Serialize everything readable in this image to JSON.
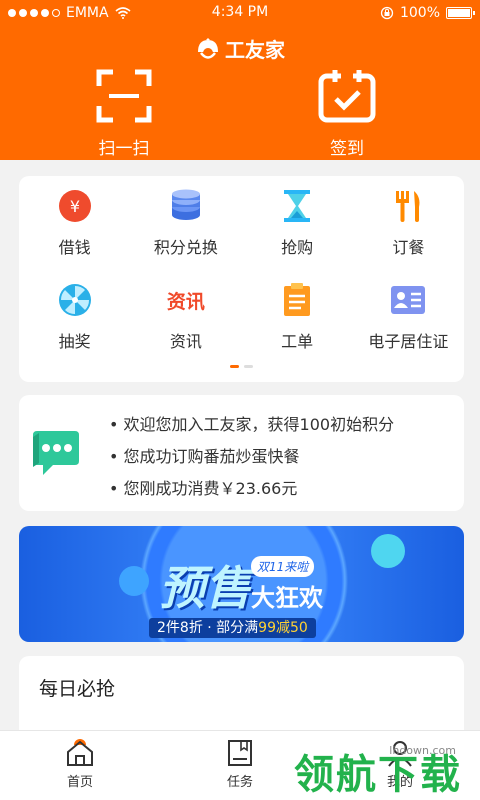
{
  "status": {
    "carrier": "EMMA",
    "time": "4:34 PM",
    "battery": "100%"
  },
  "header": {
    "app_name": "工友家",
    "scan_label": "扫一扫",
    "checkin_label": "签到"
  },
  "menu": {
    "items": [
      {
        "label": "借钱",
        "icon": "yen-coin-icon"
      },
      {
        "label": "积分兑换",
        "icon": "coin-stack-icon"
      },
      {
        "label": "抢购",
        "icon": "hourglass-icon"
      },
      {
        "label": "订餐",
        "icon": "fork-knife-icon"
      },
      {
        "label": "抽奖",
        "icon": "prize-wheel-icon"
      },
      {
        "label": "资讯",
        "icon": "news-icon"
      },
      {
        "label": "工单",
        "icon": "clipboard-icon"
      },
      {
        "label": "电子居住证",
        "icon": "id-card-icon"
      }
    ],
    "news_icon_text": "资讯",
    "page_count": 2,
    "active_page": 1
  },
  "notices": [
    "欢迎您加入工友家，获得100初始积分",
    "您成功订购番茄炒蛋快餐",
    "您刚成功消费￥23.66元"
  ],
  "banner": {
    "title": "预售",
    "tag": "双11来啦",
    "subtitle": "大狂欢",
    "promo_prefix": "2件8折 · 部分满",
    "promo_highlight": "99减50"
  },
  "daily": {
    "title": "每日必抢"
  },
  "tabs": [
    {
      "label": "首页",
      "active": true
    },
    {
      "label": "任务",
      "active": false
    },
    {
      "label": "我的",
      "active": false
    }
  ],
  "watermark": {
    "text": "领航下载",
    "url": "lhdown.com"
  },
  "colors": {
    "brand": "#ff6a00",
    "banner": "#2f7bff",
    "watermark": "#22b24c"
  }
}
